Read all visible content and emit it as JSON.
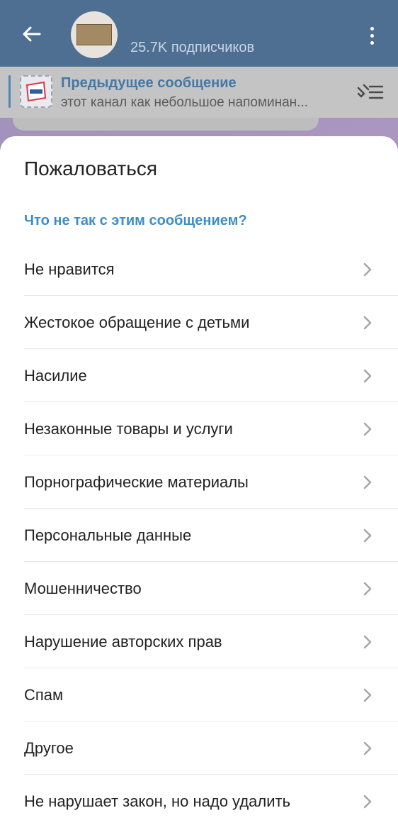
{
  "header": {
    "subscribers": "25.7K подписчиков"
  },
  "pinned": {
    "title": "Предыдущее сообщение",
    "text": "этот канал как небольшое напоминан..."
  },
  "sheet": {
    "title": "Пожаловаться",
    "subtitle": "Что не так с этим сообщением?",
    "options": [
      {
        "label": "Не нравится"
      },
      {
        "label": "Жестокое обращение с детьми"
      },
      {
        "label": "Насилие"
      },
      {
        "label": "Незаконные товары и услуги"
      },
      {
        "label": "Порнографические материалы"
      },
      {
        "label": "Персональные данные"
      },
      {
        "label": "Мошенничество"
      },
      {
        "label": "Нарушение авторских прав"
      },
      {
        "label": "Спам"
      },
      {
        "label": "Другое"
      },
      {
        "label": "Не нарушает закон, но надо удалить"
      }
    ]
  },
  "colors": {
    "header_bg": "#4e6f92",
    "accent": "#3d8dc7"
  },
  "icons": [
    "back-arrow-icon",
    "more-vertical-icon",
    "pinned-list-icon",
    "chevron-right-icon"
  ]
}
